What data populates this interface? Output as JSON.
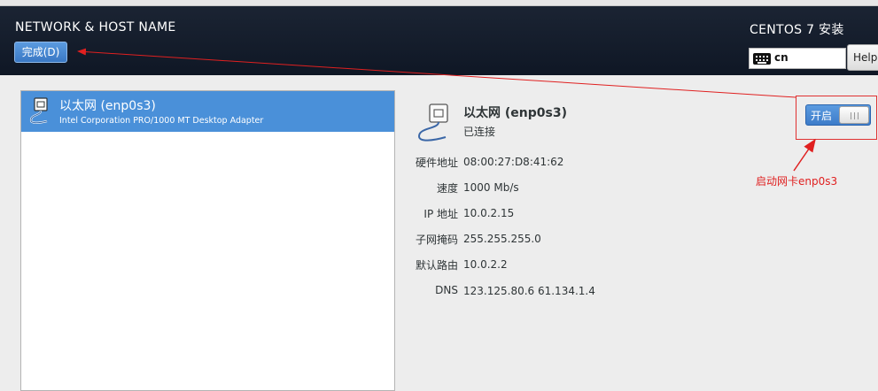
{
  "header": {
    "title": "NETWORK & HOST NAME",
    "done_label": "完成(D)",
    "product_title": "CENTOS 7 安装",
    "keyboard_layout": "cn",
    "help_label": "Help!"
  },
  "device_list": {
    "items": [
      {
        "name": "以太网 (enp0s3)",
        "description": "Intel Corporation PRO/1000 MT Desktop Adapter",
        "selected": true
      }
    ]
  },
  "details": {
    "name": "以太网 (enp0s3)",
    "status": "已连接",
    "rows": [
      {
        "label": "硬件地址",
        "value": "08:00:27:D8:41:62"
      },
      {
        "label": "速度",
        "value": "1000 Mb/s"
      },
      {
        "label": "IP 地址",
        "value": "10.0.2.15"
      },
      {
        "label": "子网掩码",
        "value": "255.255.255.0"
      },
      {
        "label": "默认路由",
        "value": "10.0.2.2"
      },
      {
        "label": "DNS",
        "value": "123.125.80.6 61.134.1.4"
      }
    ],
    "toggle_label": "开启",
    "toggle_on": true
  },
  "annotation": {
    "text": "启动网卡enp0s3",
    "color": "#e02020"
  },
  "colors": {
    "header_bg": "#111a29",
    "accent": "#4a90d9"
  }
}
